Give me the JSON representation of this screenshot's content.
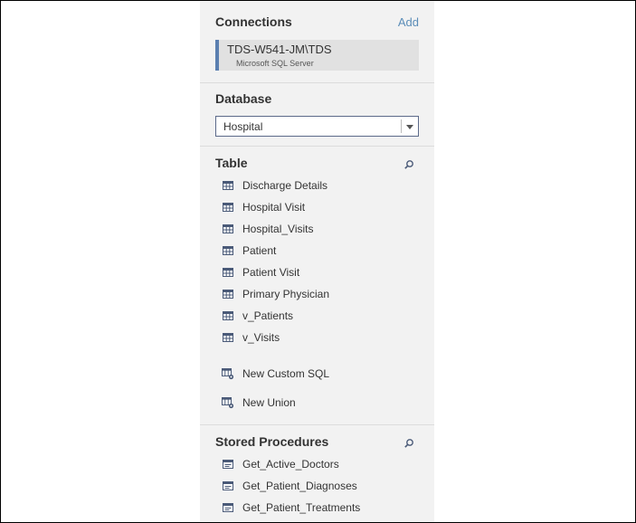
{
  "connections": {
    "title": "Connections",
    "add_label": "Add",
    "items": [
      {
        "name": "TDS-W541-JM\\TDS",
        "type": "Microsoft SQL Server"
      }
    ]
  },
  "database": {
    "title": "Database",
    "selected": "Hospital"
  },
  "tables": {
    "title": "Table",
    "items": [
      {
        "label": "Discharge Details",
        "icon": "table-icon"
      },
      {
        "label": "Hospital Visit",
        "icon": "table-icon"
      },
      {
        "label": "Hospital_Visits",
        "icon": "table-icon"
      },
      {
        "label": "Patient",
        "icon": "table-icon"
      },
      {
        "label": "Patient Visit",
        "icon": "table-icon"
      },
      {
        "label": "Primary Physician",
        "icon": "table-icon"
      },
      {
        "label": "v_Patients",
        "icon": "table-icon"
      },
      {
        "label": "v_Visits",
        "icon": "table-icon"
      }
    ],
    "actions": [
      {
        "label": "New Custom SQL",
        "icon": "custom-sql-icon"
      },
      {
        "label": "New Union",
        "icon": "union-icon"
      }
    ]
  },
  "procedures": {
    "title": "Stored Procedures",
    "items": [
      {
        "label": "Get_Active_Doctors",
        "icon": "procedure-icon"
      },
      {
        "label": "Get_Patient_Diagnoses",
        "icon": "procedure-icon"
      },
      {
        "label": "Get_Patient_Treatments",
        "icon": "procedure-icon"
      }
    ]
  },
  "colors": {
    "panel_bg": "#f2f2f2",
    "accent": "#5b8db8",
    "connection_bar": "#5b7fb0",
    "icon": "#4a5a78"
  }
}
